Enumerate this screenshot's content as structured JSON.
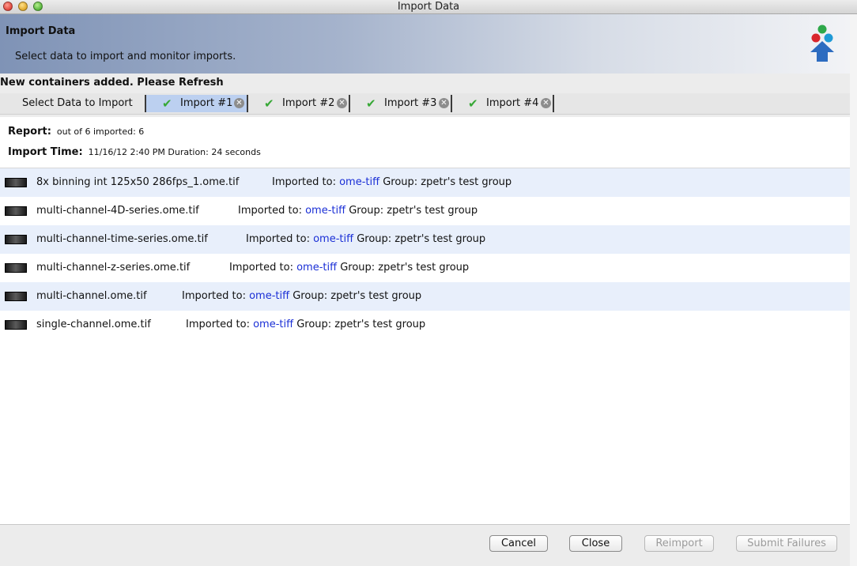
{
  "window": {
    "title": "Import Data"
  },
  "header": {
    "title": "Import Data",
    "subtitle": "Select data to import and monitor imports."
  },
  "notice": "New containers added. Please Refresh",
  "tabs": [
    {
      "label": "Select Data to Import",
      "check": false,
      "closable": false,
      "selected": false
    },
    {
      "label": "Import #1",
      "check": true,
      "closable": true,
      "selected": true
    },
    {
      "label": "Import #2",
      "check": true,
      "closable": true,
      "selected": false
    },
    {
      "label": "Import #3",
      "check": true,
      "closable": true,
      "selected": false
    },
    {
      "label": "Import #4",
      "check": true,
      "closable": true,
      "selected": false
    }
  ],
  "report": {
    "report_label": "Report:",
    "report_value": "out of 6 imported: 6",
    "time_label": "Import Time:",
    "time_value": "11/16/12 2:40 PM Duration:  24 seconds"
  },
  "files": [
    {
      "name": "8x binning int 125x50 286fps_1.ome.tif",
      "imported_to": "Imported to: ",
      "link": "ome-tiff",
      "group": " Group: zpetr's test group"
    },
    {
      "name": "multi-channel-4D-series.ome.tif",
      "imported_to": "Imported to: ",
      "link": "ome-tiff",
      "group": " Group: zpetr's test group"
    },
    {
      "name": "multi-channel-time-series.ome.tif",
      "imported_to": "Imported to: ",
      "link": "ome-tiff",
      "group": " Group: zpetr's test group"
    },
    {
      "name": "multi-channel-z-series.ome.tif",
      "imported_to": "Imported to: ",
      "link": "ome-tiff",
      "group": " Group: zpetr's test group"
    },
    {
      "name": "multi-channel.ome.tif",
      "imported_to": "Imported to: ",
      "link": "ome-tiff",
      "group": " Group: zpetr's test group"
    },
    {
      "name": "single-channel.ome.tif",
      "imported_to": "Imported to: ",
      "link": "ome-tiff",
      "group": " Group: zpetr's test group"
    }
  ],
  "buttons": {
    "cancel": "Cancel",
    "close": "Close",
    "reimport": "Reimport",
    "submit_failures": "Submit Failures"
  },
  "icons": {
    "tab_check": "checkmark-icon",
    "tab_close": "close-circle-icon",
    "logo": "omero-logo-icon",
    "thumbnail": "image-thumbnail-icon"
  },
  "colors": {
    "link": "#1a2fd6",
    "selected_tab": "#bcd0f0",
    "row_alt": "#e8effb",
    "check": "#37a836"
  }
}
